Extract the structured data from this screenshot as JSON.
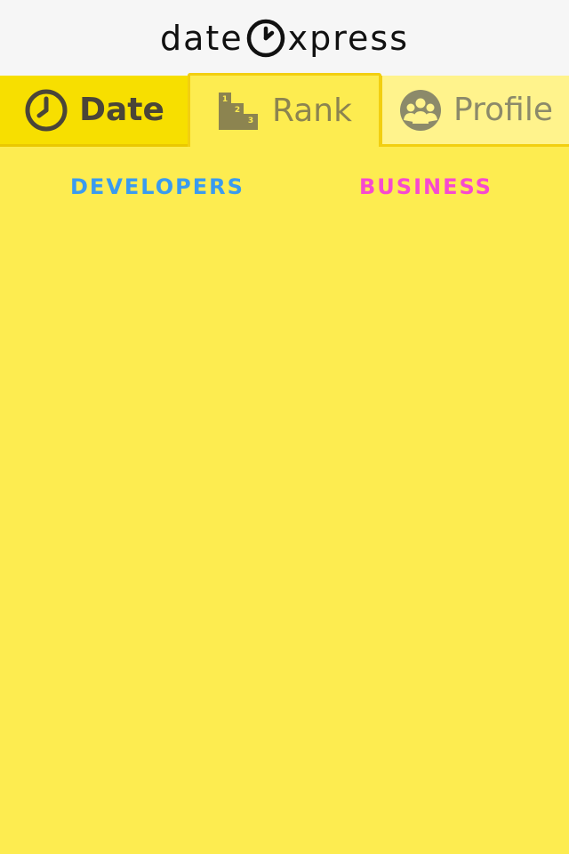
{
  "header": {
    "logo_left": "date",
    "logo_right": "xpress",
    "logo_icon": "clock-icon"
  },
  "tabs": [
    {
      "label": "Date",
      "icon": "clock-icon",
      "state": "inactive"
    },
    {
      "label": "Rank",
      "icon": "podium-icon",
      "state": "active"
    },
    {
      "label": "Profile",
      "icon": "group-icon",
      "state": "inactive"
    }
  ],
  "categories": [
    {
      "label": "DEVELOPERS",
      "color": "#3A9BEF"
    },
    {
      "label": "BUSINESS",
      "color": "#F74AD0"
    }
  ],
  "colors": {
    "background": "#FDEC50",
    "header_bg": "#F6F6F6",
    "tab_date_bg": "#F7DF00",
    "tab_profile_bg": "#FFF38C"
  }
}
